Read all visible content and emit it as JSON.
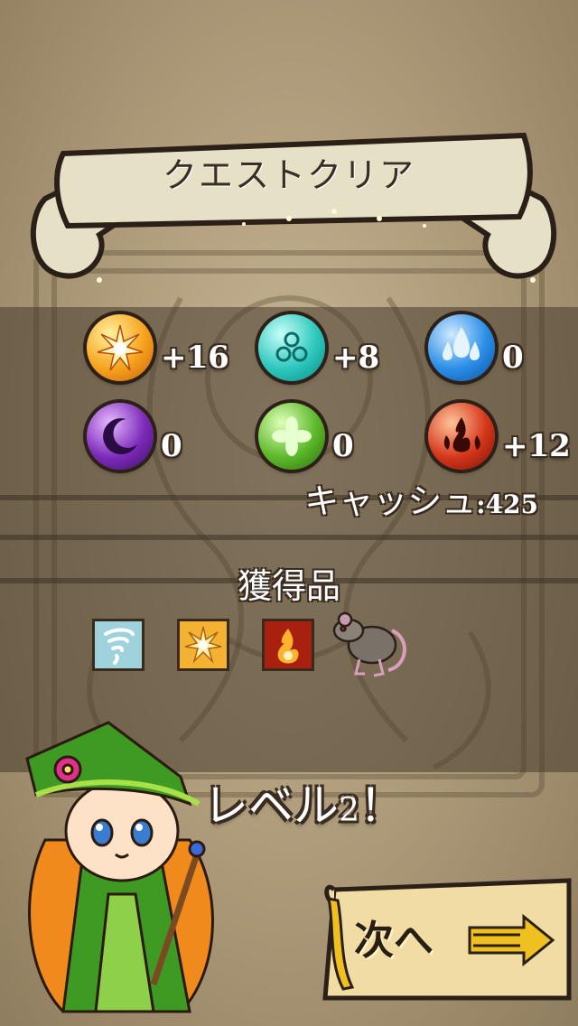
{
  "header": {
    "title": "クエストクリア"
  },
  "rewards": [
    {
      "icon": "sun-orb-icon",
      "color": "#f6a21c",
      "count": "+16"
    },
    {
      "icon": "wind-orb-icon",
      "color": "#2cc7bd",
      "count": "+8"
    },
    {
      "icon": "water-orb-icon",
      "color": "#2a8ee6",
      "count": "0"
    },
    {
      "icon": "moon-orb-icon",
      "color": "#7b2ab8",
      "count": "0"
    },
    {
      "icon": "leaf-orb-icon",
      "color": "#5cb82a",
      "count": "0"
    },
    {
      "icon": "fire-orb-icon",
      "color": "#d4361a",
      "count": "+12"
    }
  ],
  "cash": {
    "label": "キャッシュ",
    "value": ":425"
  },
  "loot": {
    "title": "獲得品",
    "items": [
      "tornado-card-icon",
      "sun-card-icon",
      "fire-card-icon",
      "rat-icon"
    ]
  },
  "level_up": {
    "text": "レベル",
    "number": "2",
    "suffix": "！"
  },
  "next_button": {
    "label": "次へ"
  }
}
